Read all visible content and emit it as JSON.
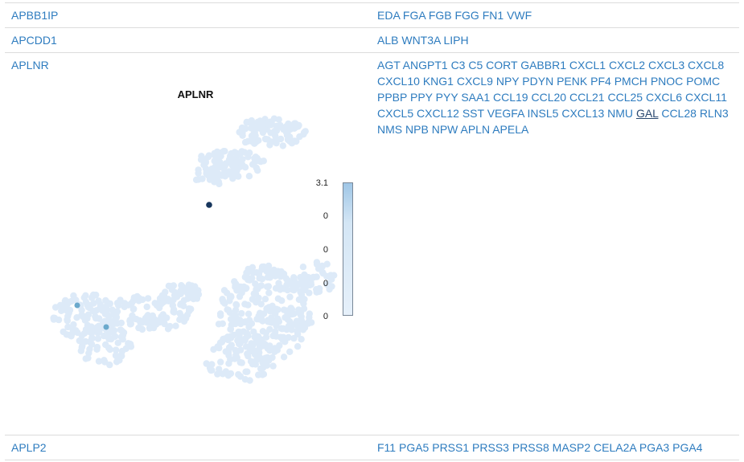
{
  "rows": [
    {
      "gene": "APBB1IP",
      "ligands": [
        "EDA",
        "FGA",
        "FGB",
        "FGG",
        "FN1",
        "VWF"
      ]
    },
    {
      "gene": "APCDD1",
      "ligands": [
        "ALB",
        "WNT3A",
        "LIPH"
      ]
    },
    {
      "gene": "APLNR",
      "ligands": [
        "AGT",
        "ANGPT1",
        "C3",
        "C5",
        "CORT",
        "GABBR1",
        "CXCL1",
        "CXCL2",
        "CXCL3",
        "CXCL8",
        "CXCL10",
        "KNG1",
        "CXCL9",
        "NPY",
        "PDYN",
        "PENK",
        "PF4",
        "PMCH",
        "PNOC",
        "POMC",
        "PPBP",
        "PPY",
        "PYY",
        "SAA1",
        "CCL19",
        "CCL20",
        "CCL21",
        "CCL25",
        "CXCL6",
        "CXCL11",
        "CXCL5",
        "CXCL12",
        "SST",
        "VEGFA",
        "INSL5",
        "CXCL13",
        "NMU",
        "GAL",
        "CCL28",
        "RLN3",
        "NMS",
        "NPB",
        "NPW",
        "APLN",
        "APELA"
      ],
      "underlined": "GAL"
    },
    {
      "gene": "APLP2",
      "ligands": [
        "F11",
        "PGA5",
        "PRSS1",
        "PRSS3",
        "PRSS8",
        "MASP2",
        "CELA2A",
        "PGA3",
        "PGA4"
      ]
    }
  ],
  "plot": {
    "title": "APLNR",
    "colorbar_ticks": [
      "3.1",
      "0",
      "0",
      "0",
      "0"
    ],
    "colors": {
      "low": "#ddeaf8",
      "mid": "#6ba9cc",
      "high": "#17365d"
    }
  }
}
